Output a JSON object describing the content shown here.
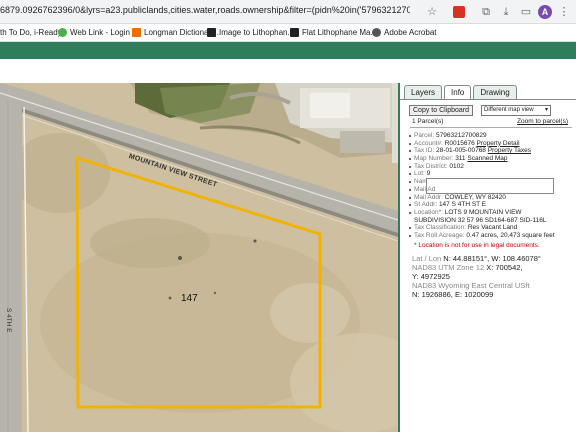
{
  "browser": {
    "url": "6879.0926762396/0&lyrs=a23.publiclands,cities.water,roads.ownership&filter=(pidn%20in('57963212700829'))",
    "profile_initial": "A"
  },
  "bookmarks": [
    {
      "label": "th To Do, i-Ready",
      "color": "#f2a33a"
    },
    {
      "label": "Web Link - Login",
      "color": "#4caf50"
    },
    {
      "label": "Longman Dictionary...",
      "color": "#ef6c00"
    },
    {
      "label": "Image to Lithophan...",
      "color": "#222222"
    },
    {
      "label": "Flat Lithophane Ma...",
      "color": "#222222"
    },
    {
      "label": "Adobe Acrobat",
      "color": "#555555"
    }
  ],
  "map": {
    "street_name": "MOUNTAIN VIEW STREET",
    "side_street": "S 4TH E",
    "parcel_label": "147"
  },
  "panel": {
    "tabs": [
      "Layers",
      "Info",
      "Drawing"
    ],
    "copy_button": "Copy to Clipboard",
    "map_view_option": "Different map view",
    "parcel_count": "1 Parcel(s)",
    "zoom_link": "Zoom to parcel(s)",
    "fields": [
      {
        "label": "Parcel:",
        "value": "57963212700829",
        "link": ""
      },
      {
        "label": "Account#:",
        "value": "R0015676",
        "link": "Property Detail"
      },
      {
        "label": "Tax ID:",
        "value": "28-01-005-00768",
        "link": "Property Taxes"
      },
      {
        "label": "Map Number:",
        "value": "311",
        "link": "Scanned Map"
      },
      {
        "label": "Tax District:",
        "value": "0102",
        "link": ""
      },
      {
        "label": "Lot:",
        "value": "9",
        "link": ""
      },
      {
        "label": "Name:",
        "value": "",
        "link": ""
      },
      {
        "label": "Mail Ad",
        "value": "",
        "link": ""
      },
      {
        "label": "Mail Addr:",
        "value": "COWLEY, WY 82420",
        "link": ""
      },
      {
        "label": "St Addr:",
        "value": "147 S 4TH ST E",
        "link": ""
      },
      {
        "label": "Location*:",
        "value": "LOTS 9 MOUNTAIN VIEW",
        "link": ""
      },
      {
        "label": "",
        "value": "SUBDIVISION 32 57 96 SD164-687 SID-116L",
        "link": ""
      },
      {
        "label": "Tax Classification:",
        "value": "Res Vacant Land",
        "link": ""
      },
      {
        "label": "Tax Roll Acreage:",
        "value": "0.47 acres, 20,473 square feet",
        "link": ""
      }
    ],
    "note": "* Location is not for use in legal documents.",
    "latlon_label": "Lat / Lon",
    "latlon_value": "N: 44.88151°, W: 108.46078°",
    "utm_label": "NAD83 UTM Zone 12",
    "utm_x": "X: 700542,",
    "utm_y": "Y: 4972925",
    "stateplane_label": "NAD83 Wyoming East Central USft",
    "stateplane_value": "N: 1926886, E: 1020099"
  }
}
